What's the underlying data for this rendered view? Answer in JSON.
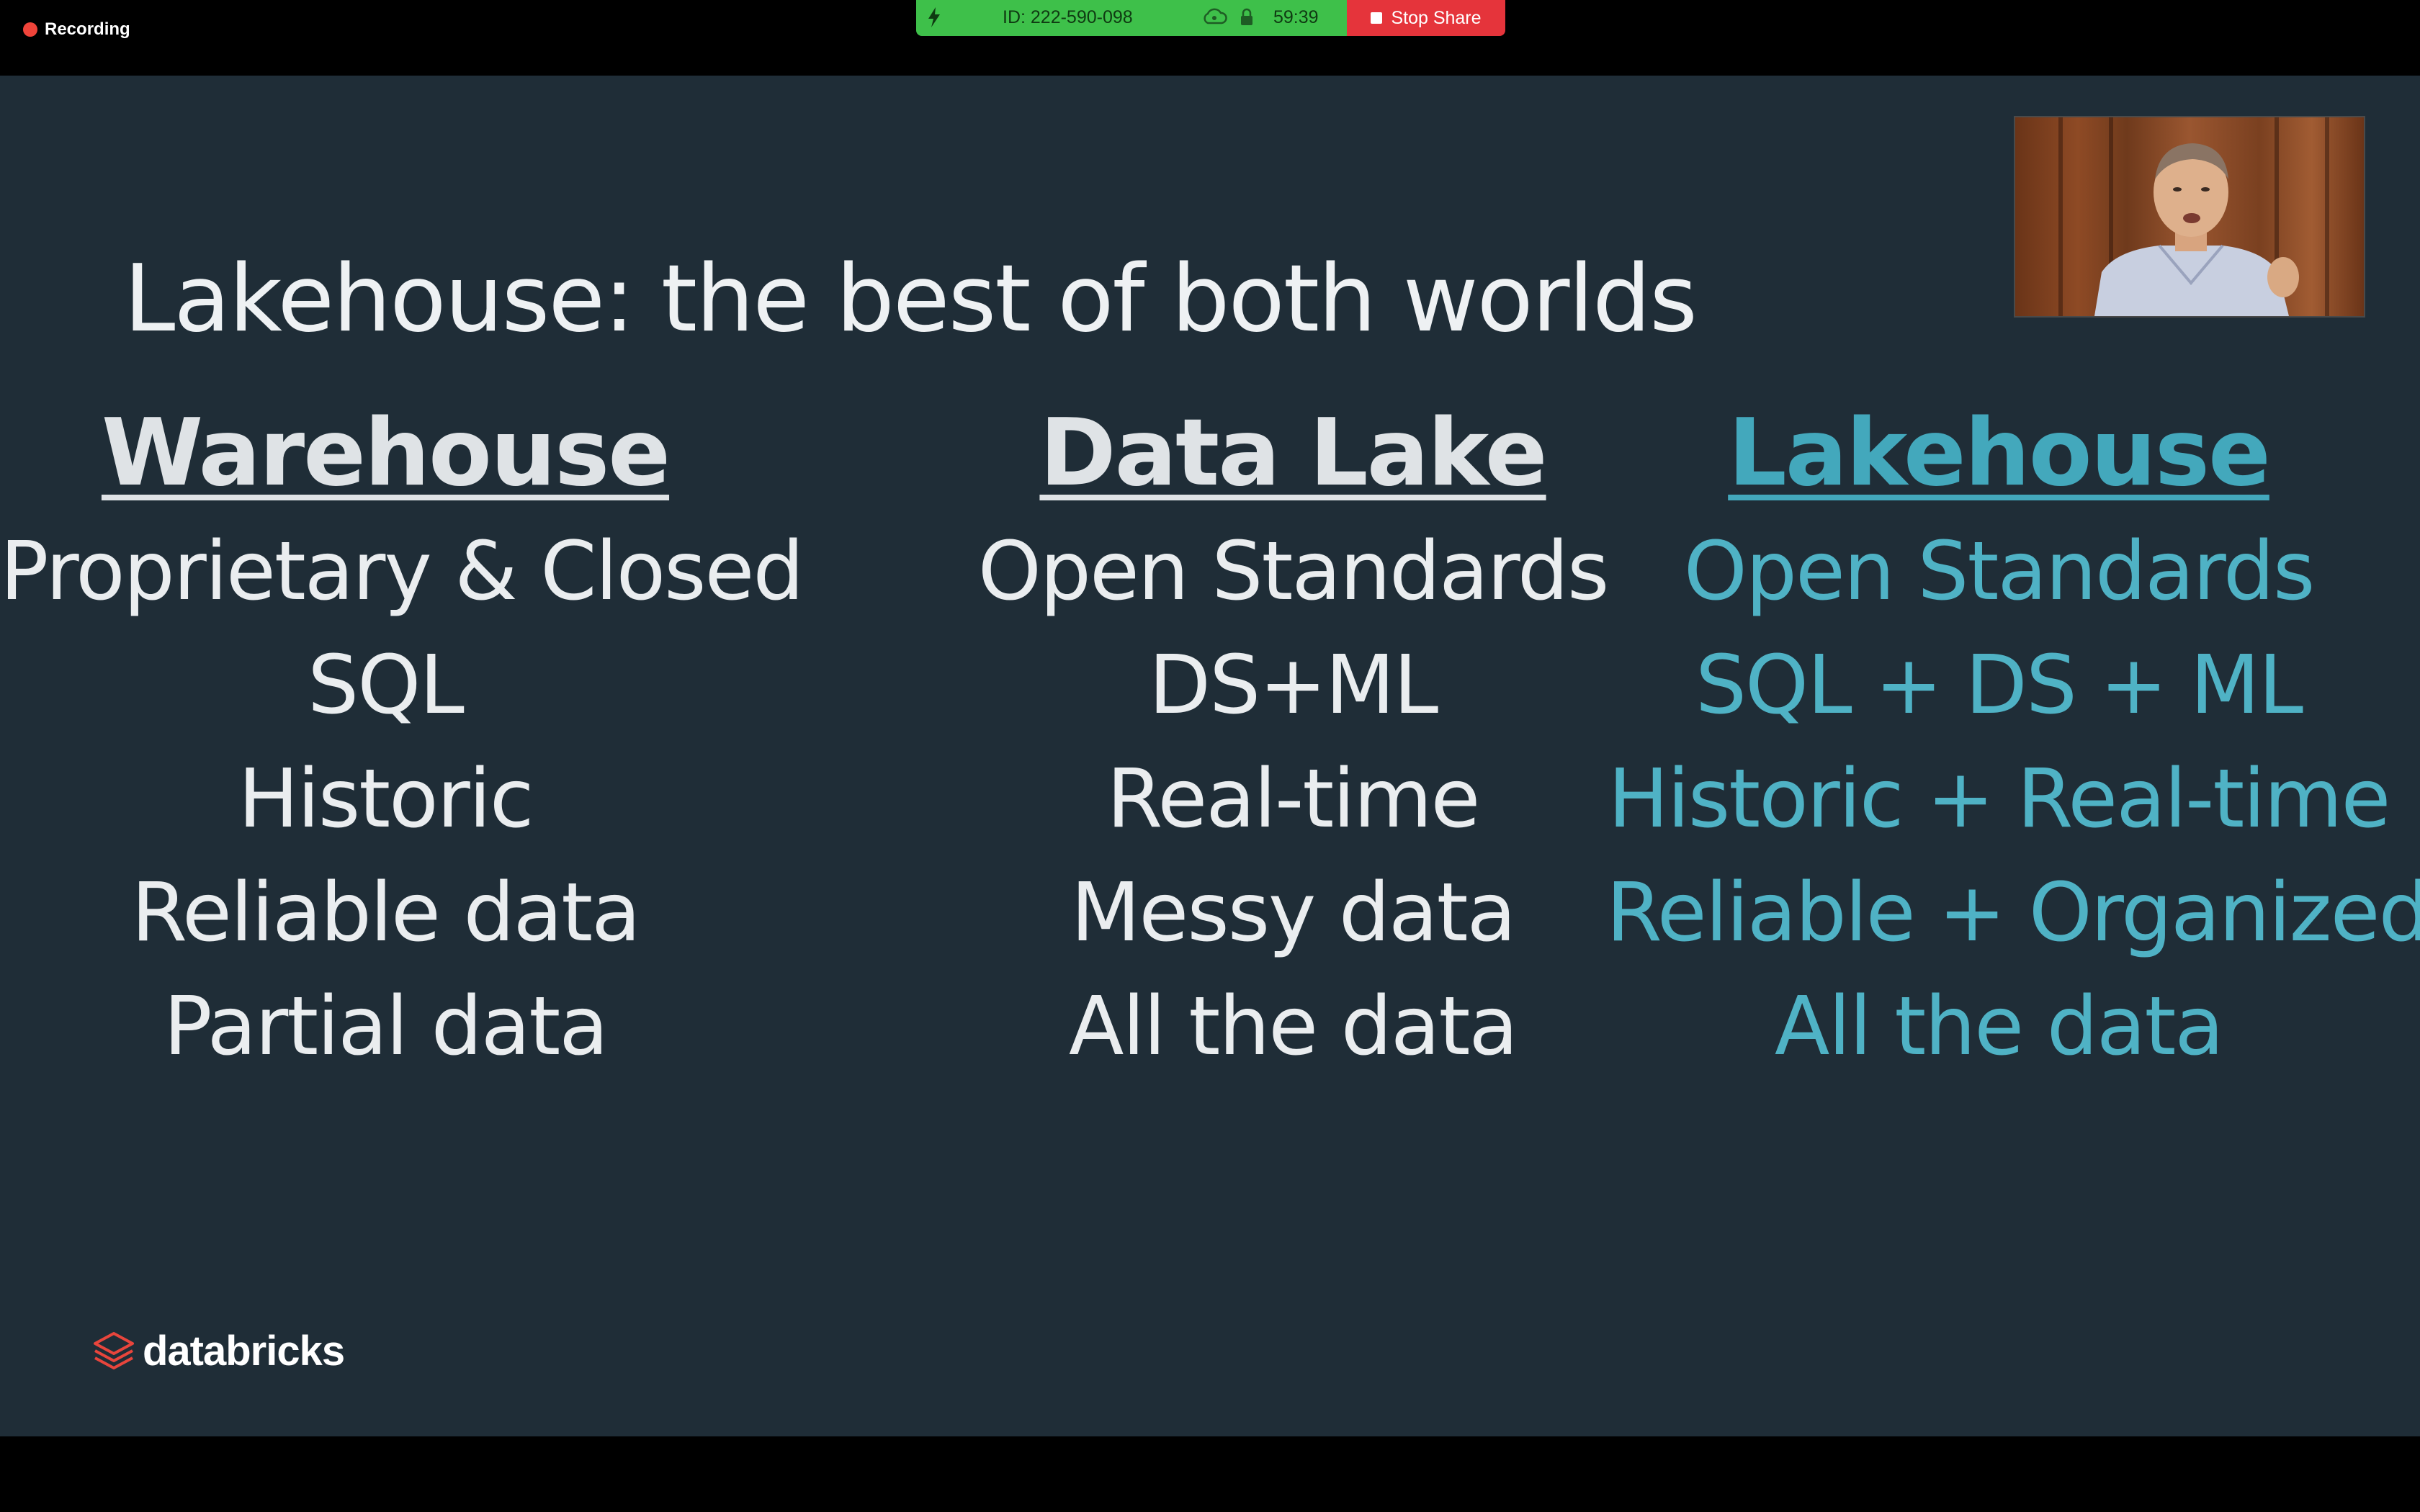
{
  "recording": {
    "label": "Recording"
  },
  "share_bar": {
    "meeting_id": "ID: 222-590-098",
    "timer": "59:39",
    "stop_label": "Stop Share"
  },
  "slide": {
    "title": "Lakehouse: the best of both worlds",
    "columns": [
      {
        "heading": "Warehouse",
        "items": [
          "Proprietary & Closed",
          "SQL",
          "Historic",
          "Reliable data",
          "Partial data"
        ]
      },
      {
        "heading": "Data Lake",
        "items": [
          "Open Standards",
          "DS+ML",
          "Real-time",
          "Messy data",
          "All the data"
        ]
      },
      {
        "heading": "Lakehouse",
        "items": [
          "Open Standards",
          "SQL + DS + ML",
          "Historic + Real-time",
          "Reliable + Organized",
          "All the data"
        ]
      }
    ],
    "brand": "databricks"
  },
  "colors": {
    "slide_background": "#1f2d37",
    "text_white": "#eaedef",
    "text_teal": "#4fb2c5",
    "share_green": "#3ec04a",
    "stop_red": "#e5343b",
    "brand_red": "#e8453c"
  }
}
